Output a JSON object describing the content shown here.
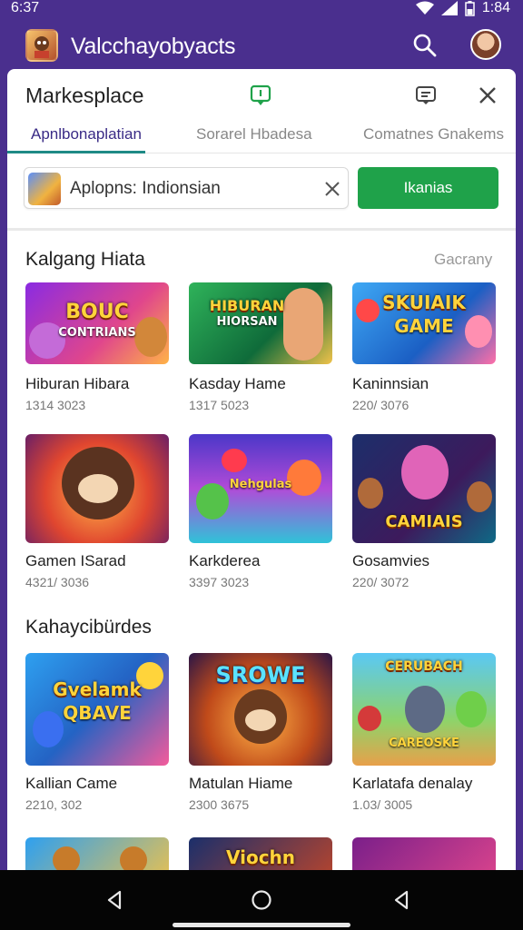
{
  "status": {
    "time": "6:37",
    "right_time": "1:84"
  },
  "app": {
    "title": "Valcchayobyacts",
    "logo_icon": "game-logo-icon"
  },
  "card": {
    "title": "Markesplace"
  },
  "tabs": [
    {
      "label": "Apnlbonaplatian"
    },
    {
      "label": "Sorarel Hbadesa"
    },
    {
      "label": "Comatnes Gnakems"
    }
  ],
  "search": {
    "value": "Aplopns: Indionsian",
    "button_label": "Ikanias"
  },
  "sections": [
    {
      "title": "Kalgang Hiata",
      "link": "Gacrany",
      "items": [
        {
          "name": "Hiburan Hibara",
          "meta": "1314 3023",
          "art": "BOUC",
          "art_sub": "CONTRIANS"
        },
        {
          "name": "Kasday Hame",
          "meta": "1317 5023",
          "art": "HIBURAN",
          "art_sub": "HIORSAN"
        },
        {
          "name": "Kaninnsian",
          "meta": "220/ 3076",
          "art": "SKUIAIK",
          "art_sub": "GAME"
        },
        {
          "name": "Gamen  ISarad",
          "meta": "4321/ 3036",
          "art": "",
          "art_sub": ""
        },
        {
          "name": "Karkderea",
          "meta": "3397 3023",
          "art": "",
          "art_sub": "Nehgulas"
        },
        {
          "name": "Gosamvies",
          "meta": "220/ 3072",
          "art": "CAMIAIS",
          "art_sub": ""
        }
      ]
    },
    {
      "title": "Kahaycibürdes",
      "items": [
        {
          "name": "Kallian Came",
          "meta": "2210, 302",
          "art": "Gvelamk",
          "art_sub": "QBAVE"
        },
        {
          "name": "Matulan Hiame",
          "meta": "2300 3675",
          "art": "SROWE",
          "art_sub": ""
        },
        {
          "name": "Karlatafa denalay",
          "meta": "1.03/ 3005",
          "art": "CERUBACH",
          "art_sub": "CAREOSKE"
        },
        {
          "name": "",
          "meta": "",
          "art": "",
          "art_sub": ""
        },
        {
          "name": "",
          "meta": "",
          "art": "Viochn",
          "art_sub": ""
        },
        {
          "name": "",
          "meta": "",
          "art": "",
          "art_sub": ""
        }
      ]
    }
  ],
  "colors": {
    "app_bar": "#4a2f8e",
    "accent_tab": "#1f8a86",
    "button": "#1fa24a"
  }
}
